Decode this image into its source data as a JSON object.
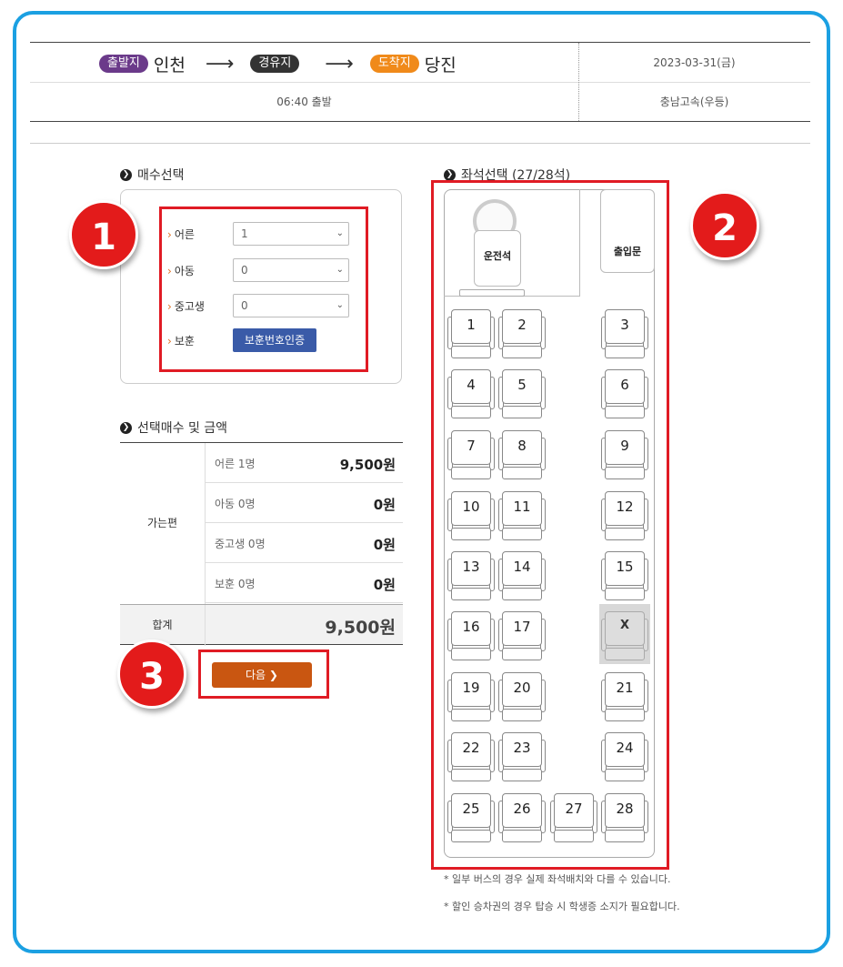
{
  "route": {
    "departure_tag": "출발지",
    "departure_city": "인천",
    "via_tag": "경유지",
    "arrival_tag": "도착지",
    "arrival_city": "당진",
    "date": "2023-03-31(금)",
    "departure_time": "06:40 출발",
    "bus_company": "충남고속(우등)"
  },
  "ticket_count": {
    "title": "매수선택",
    "rows": [
      {
        "label": "어른",
        "value": "1"
      },
      {
        "label": "아동",
        "value": "0"
      },
      {
        "label": "중고생",
        "value": "0"
      }
    ],
    "veteran_label": "보훈",
    "veteran_button": "보훈번호인증"
  },
  "summary": {
    "title": "선택매수 및 금액",
    "direction_label": "가는편",
    "rows": [
      {
        "label": "어른 1명",
        "amount": "9,500원"
      },
      {
        "label": "아동 0명",
        "amount": "0원"
      },
      {
        "label": "중고생 0명",
        "amount": "0원"
      },
      {
        "label": "보훈 0명",
        "amount": "0원"
      }
    ],
    "total_label": "합계",
    "total_amount": "9,500원"
  },
  "next_button": "다음 ❯",
  "seat_select": {
    "title": "좌석선택 (27/28석)",
    "driver_label": "운전석",
    "door_label": "출입문",
    "seats": [
      "1",
      "2",
      "3",
      "4",
      "5",
      "6",
      "7",
      "8",
      "9",
      "10",
      "11",
      "12",
      "13",
      "14",
      "15",
      "16",
      "17",
      "X",
      "19",
      "20",
      "21",
      "22",
      "23",
      "24",
      "25",
      "26",
      "27",
      "28"
    ],
    "notes": [
      "* 일부 버스의 경우 실제 좌석배치와 다를 수 있습니다.",
      "* 할인 승차권의 경우 탑승 시 학생증 소지가 필요합니다."
    ]
  },
  "step_markers": [
    "1",
    "2",
    "3"
  ],
  "colors": {
    "frame": "#1ba0e2",
    "departure_tag": "#6b3a8a",
    "arrival_tag": "#f08a1a",
    "veteran_button": "#3a5ba8",
    "next_button": "#c95611",
    "highlight": "#e01b24"
  }
}
